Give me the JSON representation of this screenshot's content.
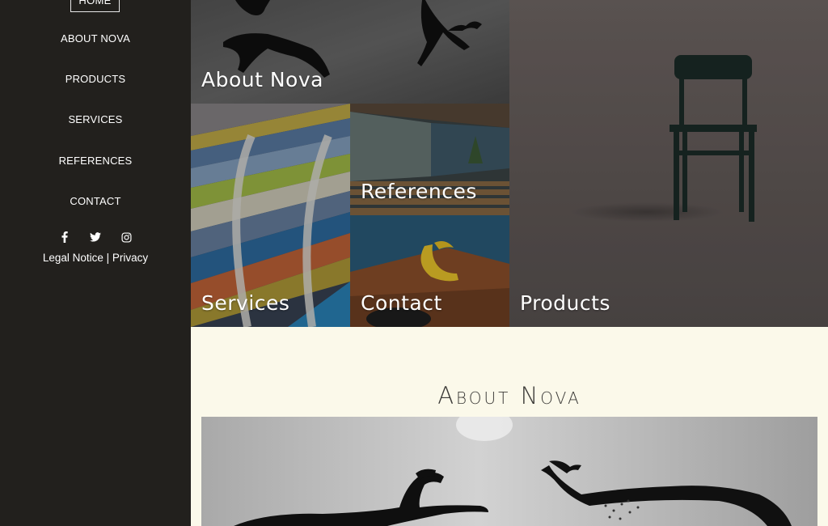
{
  "sidebar": {
    "home": "HOME",
    "items": [
      {
        "label": "ABOUT NOVA"
      },
      {
        "label": "PRODUCTS"
      },
      {
        "label": "SERVICES"
      },
      {
        "label": "REFERENCES"
      },
      {
        "label": "CONTACT"
      }
    ],
    "social_icons": [
      "facebook-icon",
      "twitter-icon",
      "instagram-icon"
    ],
    "legal_notice": "Legal Notice",
    "separator": "|",
    "privacy": "Privacy"
  },
  "tiles": {
    "about": "About Nova",
    "services": "Services",
    "references": "References",
    "contact": "Contact",
    "products": "Products"
  },
  "main": {
    "heading": "About Nova"
  },
  "colors": {
    "sidebar_bg": "#22201d",
    "page_bg": "#fbf9ea",
    "text_light": "#ffffff",
    "heading": "#3c3b38"
  }
}
